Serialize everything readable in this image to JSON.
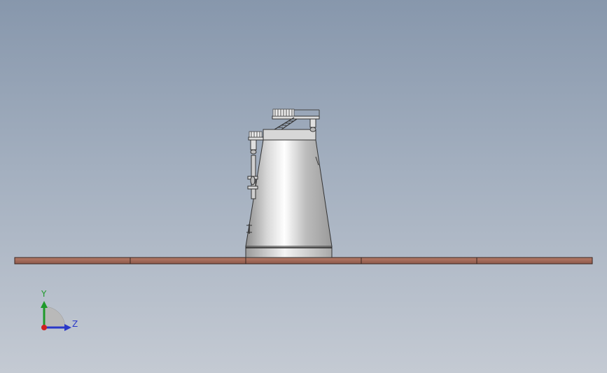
{
  "viewport": {
    "background_top": "#8797ac",
    "background_bottom": "#c4cad3"
  },
  "model": {
    "description_icon": "tank-assembly-icon",
    "floor_color": "#a26a58",
    "tank_color": "#c8c8c8"
  },
  "triad": {
    "y_label": "Y",
    "z_label": "Z",
    "y_color": "#1f9a2a",
    "z_color": "#2a38c8",
    "origin_color": "#d02020"
  }
}
